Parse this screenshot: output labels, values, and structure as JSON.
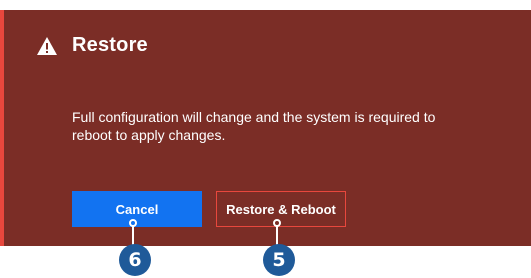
{
  "dialog": {
    "title": "Restore",
    "title_icon": "warning-triangle-icon",
    "message": "Full configuration will change and the system is required to reboot to apply changes.",
    "cancel_label": "Cancel",
    "restore_label": "Restore & Reboot"
  },
  "callouts": {
    "cancel_number": "6",
    "restore_number": "5"
  },
  "colors": {
    "dialog_background": "#7b2d26",
    "accent_red": "#e8473d",
    "cancel_blue": "#1273f1",
    "callout_blue": "#1f5a99",
    "text": "#ffffff"
  }
}
